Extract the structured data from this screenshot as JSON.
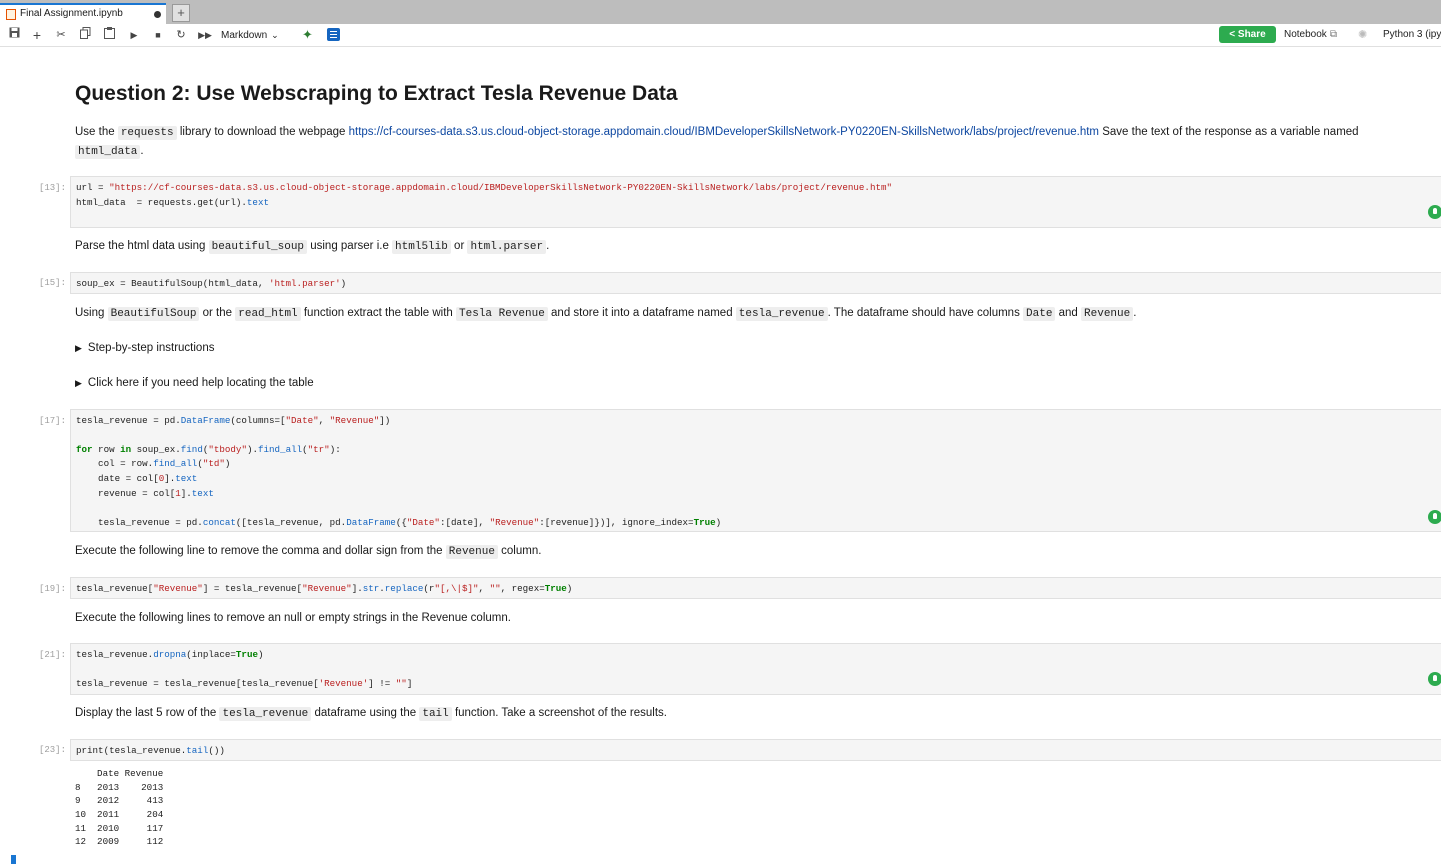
{
  "tab": {
    "label": "Final Assignment.ipynb",
    "new_tab": "+"
  },
  "toolbar": {
    "cell_type": "Markdown",
    "share_label": "Share",
    "notebook_label": "Notebook",
    "kernel": "Python 3 (ipy"
  },
  "heading": "Question 2: Use Webscraping to Extract Tesla Revenue Data",
  "md1": {
    "t1": "Use the ",
    "c1": "requests",
    "t2": " library to download the webpage ",
    "link": "https://cf-courses-data.s3.us.cloud-object-storage.appdomain.cloud/IBMDeveloperSkillsNetwork-PY0220EN-SkillsNetwork/labs/project/revenue.htm",
    "t3": " Save the text of the response as a variable named",
    "c2": "html_data",
    "t4": "."
  },
  "cell13": {
    "prompt": "[13]:",
    "lines": [
      "url = \"https://cf-courses-data.s3.us.cloud-object-storage.appdomain.cloud/IBMDeveloperSkillsNetwork-PY0220EN-SkillsNetwork/labs/project/revenue.htm\"",
      "html_data  = requests.get(url).text"
    ]
  },
  "md2": {
    "t1": "Parse the html data using ",
    "c1": "beautiful_soup",
    "t2": " using parser i.e ",
    "c2": "html5lib",
    "t3": " or ",
    "c3": "html.parser",
    "t4": "."
  },
  "cell15": {
    "prompt": "[15]:",
    "lines": [
      "soup_ex = BeautifulSoup(html_data, 'html.parser')"
    ]
  },
  "md3": {
    "t1": "Using ",
    "c1": "BeautifulSoup",
    "t2": " or the ",
    "c2": "read_html",
    "t3": " function extract the table with ",
    "c3": "Tesla Revenue",
    "t4": " and store it into a dataframe named ",
    "c4": "tesla_revenue",
    "t5": ". The dataframe should have columns ",
    "c5": "Date",
    "t6": " and ",
    "c6": "Revenue",
    "t7": "."
  },
  "details": [
    "Step-by-step instructions",
    "Click here if you need help locating the table"
  ],
  "cell17": {
    "prompt": "[17]:",
    "lines": [
      "tesla_revenue = pd.DataFrame(columns=[\"Date\", \"Revenue\"])",
      "",
      "for row in soup_ex.find(\"tbody\").find_all(\"tr\"):",
      "    col = row.find_all(\"td\")",
      "    date = col[0].text",
      "    revenue = col[1].text",
      "",
      "    tesla_revenue = pd.concat([tesla_revenue, pd.DataFrame({\"Date\":[date], \"Revenue\":[revenue]})], ignore_index=True)"
    ]
  },
  "md4": {
    "t1": "Execute the following line to remove the comma and dollar sign from the ",
    "c1": "Revenue",
    "t2": " column."
  },
  "cell19": {
    "prompt": "[19]:",
    "lines": [
      "tesla_revenue[\"Revenue\"] = tesla_revenue[\"Revenue\"].str.replace(r\"[,\\|$]\", \"\", regex=True)"
    ]
  },
  "md5": {
    "t1": "Execute the following lines to remove an null or empty strings in the Revenue column."
  },
  "cell21": {
    "prompt": "[21]:",
    "lines": [
      "tesla_revenue.dropna(inplace=True)",
      "",
      "tesla_revenue = tesla_revenue[tesla_revenue['Revenue'] != \"\"]"
    ]
  },
  "md6": {
    "t1": "Display the last 5 row of the ",
    "c1": "tesla_revenue",
    "t2": " dataframe using the ",
    "c2": "tail",
    "t3": " function. Take a screenshot of the results."
  },
  "cell23": {
    "prompt": "[23]:",
    "lines": [
      "print(tesla_revenue.tail())"
    ],
    "output": [
      "    Date Revenue",
      "8   2013    2013",
      "9   2012     413",
      "10  2011     204",
      "11  2010     117",
      "12  2009     112"
    ]
  }
}
